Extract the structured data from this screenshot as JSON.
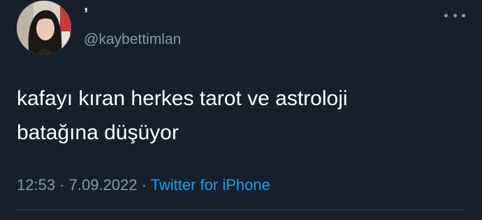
{
  "tweet": {
    "display_name": "’",
    "handle": "@kaybettimlan",
    "text": "kafayı kıran herkes tarot ve astroloji\nbatağına düşüyor",
    "time": "12:53",
    "separator": " · ",
    "date": "7.09.2022",
    "source": "Twitter for iPhone"
  },
  "icons": {
    "more": "more-horizontal-icon",
    "avatar": "profile-photo"
  },
  "colors": {
    "background": "#15202b",
    "text": "#ffffff",
    "secondary": "#8b98a5",
    "link": "#1d9bf0",
    "divider": "#38444d"
  }
}
